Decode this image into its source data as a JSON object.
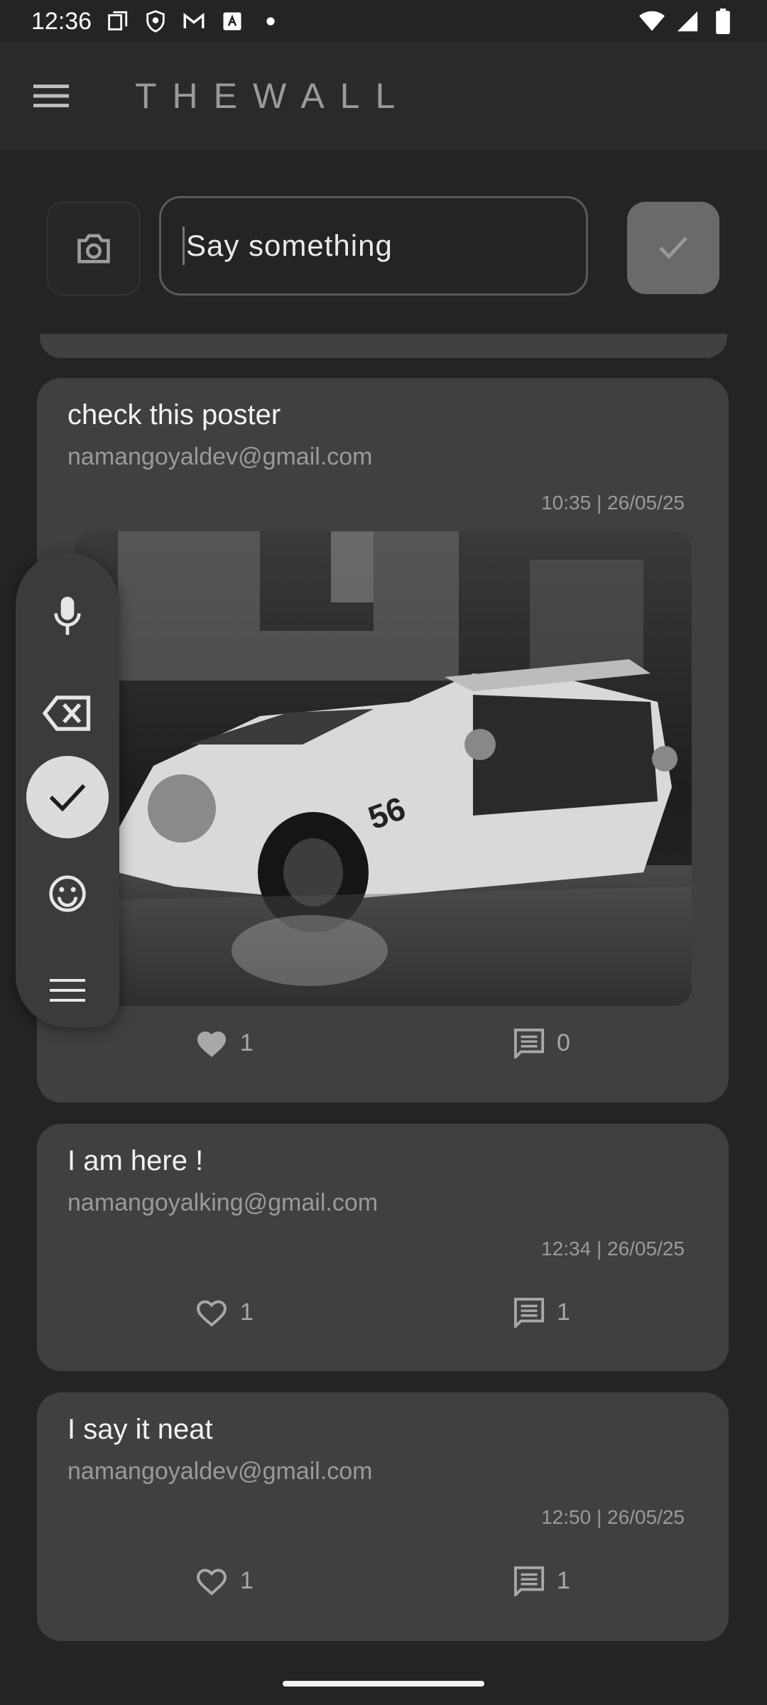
{
  "status_bar": {
    "time": "12:36"
  },
  "app": {
    "title": "THEWALL"
  },
  "composer": {
    "placeholder": "Say something"
  },
  "posts": [
    {
      "title": "check this poster",
      "email": "namangoyaldev@gmail.com",
      "timestamp": "10:35 | 26/05/25",
      "has_image": true,
      "likes": "1",
      "liked": true,
      "comments": "0"
    },
    {
      "title": "I am here !",
      "email": "namangoyalking@gmail.com",
      "timestamp": "12:34 | 26/05/25",
      "has_image": false,
      "likes": "1",
      "liked": false,
      "comments": "1"
    },
    {
      "title": "I say it neat",
      "email": "namangoyaldev@gmail.com",
      "timestamp": "12:50 | 26/05/25",
      "has_image": false,
      "likes": "1",
      "liked": false,
      "comments": "1"
    }
  ],
  "keyboard_toolbar": {
    "items": [
      "mic-icon",
      "backspace-icon",
      "check-icon",
      "emoji-icon",
      "menu-icon"
    ],
    "active_index": 2
  },
  "colors": {
    "background": "#242424",
    "card": "#404040",
    "accent_button": "#6a6a6a"
  }
}
